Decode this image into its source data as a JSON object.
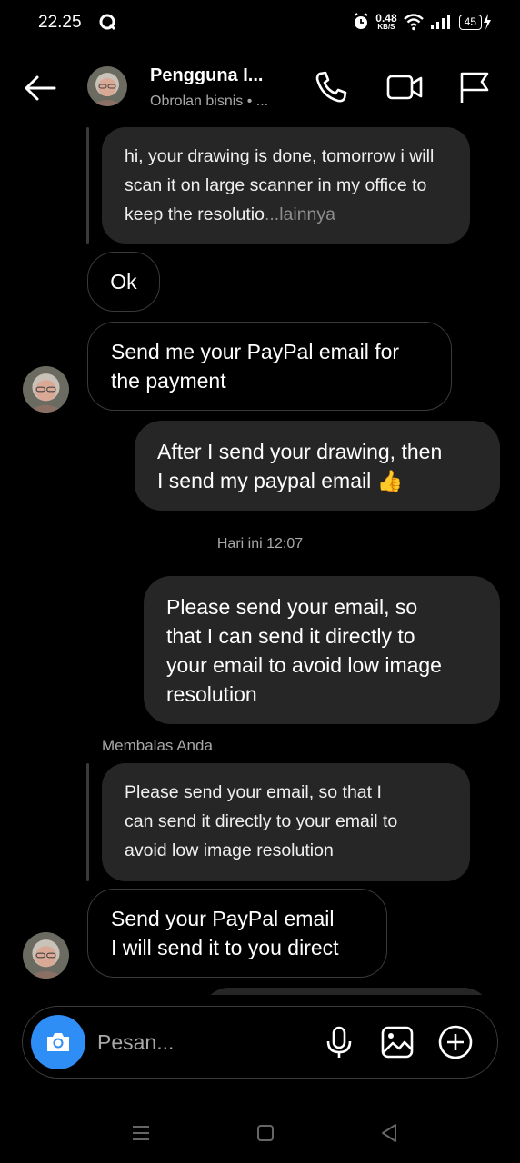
{
  "status_bar": {
    "time": "22.25",
    "net_speed_value": "0.48",
    "net_speed_unit": "KB/S",
    "battery": "45"
  },
  "header": {
    "contact_name": "Pengguna I...",
    "subtitle": "Obrolan bisnis • ..."
  },
  "messages": {
    "quoted_1_text": "hi, your drawing is done, tomorrow i will scan it on large scanner in my office to keep the resolutio",
    "quoted_1_more": "...lainnya",
    "msg_ok": "Ok",
    "msg_paypal_line1": "Send me your PayPal email for",
    "msg_paypal_line2": "the payment",
    "msg_after_line1": "After I send your drawing, then",
    "msg_after_line2": "I send my paypal email",
    "msg_after_emoji": "👍",
    "timestamp": "Hari ini 12:07",
    "msg_please_line1": "Please send your email, so",
    "msg_please_line2": "that I can send it directly to",
    "msg_please_line3": "your email to avoid low image",
    "msg_please_line4": "resolution",
    "reply_label": "Membalas Anda",
    "quoted_2_line1": "Please send your email, so that I",
    "quoted_2_line2": "can send it directly to your email to",
    "quoted_2_line3": "avoid low image resolution",
    "msg_send_line1": "Send your PayPal email",
    "msg_send_line2": "I will send it to you direct"
  },
  "composer": {
    "placeholder": "Pesan..."
  },
  "icons": {
    "back": "arrow-left-icon",
    "phone": "phone-icon",
    "video": "video-camera-icon",
    "flag": "flag-icon",
    "camera": "camera-icon",
    "mic": "microphone-icon",
    "gallery": "image-icon",
    "add": "plus-circle-icon"
  },
  "colors": {
    "background": "#000000",
    "bubble": "#262626",
    "camera_button": "#2f8df6",
    "secondary_text": "#a8a8a8"
  }
}
